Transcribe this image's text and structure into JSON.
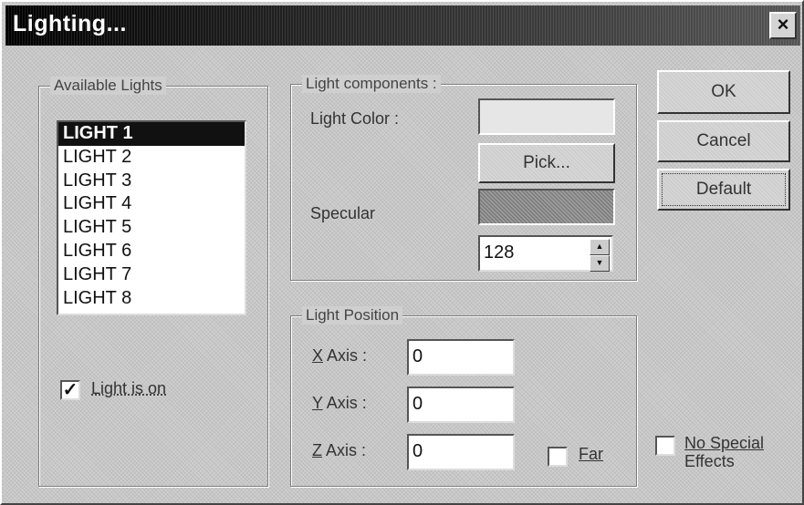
{
  "window": {
    "title": "Lighting...",
    "close_glyph": "×"
  },
  "available_lights": {
    "legend": "Available Lights",
    "items": [
      "LIGHT 1",
      "LIGHT 2",
      "LIGHT 3",
      "LIGHT 4",
      "LIGHT 5",
      "LIGHT 6",
      "LIGHT 7",
      "LIGHT 8"
    ],
    "selected_index": 0,
    "light_on_label": "Light is on",
    "light_on_checked": true
  },
  "light_components": {
    "legend": "Light components :",
    "light_color_label": "Light Color :",
    "pick_button": "Pick...",
    "specular_label": "Specular",
    "specular_value": "128"
  },
  "light_position": {
    "legend": "Light Position",
    "x_axis": {
      "accel": "X",
      "label": " Axis :",
      "value": "0"
    },
    "y_axis": {
      "accel": "Y",
      "label": " Axis :",
      "value": "0"
    },
    "z_axis": {
      "accel": "Z",
      "label": " Axis :",
      "value": "0"
    },
    "far_label": "Far"
  },
  "buttons": {
    "ok": "OK",
    "cancel": "Cancel",
    "default": "Default"
  },
  "no_special_effects": {
    "line1": "No Special",
    "line2": "Effects"
  },
  "colors": {
    "title_bar": "#1a1a1a",
    "selection": "#111111",
    "dialog_bg": "#cfcfcf"
  }
}
